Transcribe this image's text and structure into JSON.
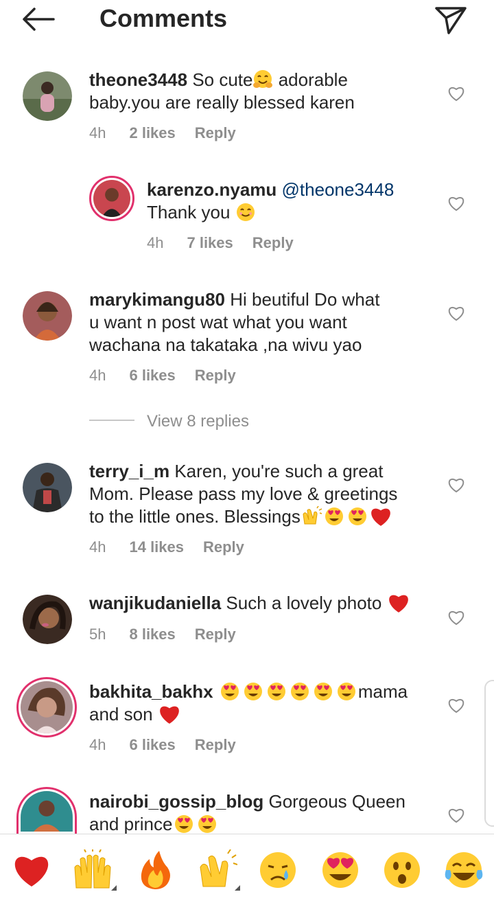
{
  "header": {
    "title": "Comments",
    "back_icon": "back-arrow-icon",
    "send_icon": "send-icon"
  },
  "comments": [
    {
      "username": "theone3448",
      "text_line1": "So cute",
      "text_line1b": " adorable",
      "text_line2": "baby.you are really blessed karen",
      "time": "4h",
      "likes": "2 likes",
      "reply": "Reply",
      "emoji": [
        "hugging-face"
      ]
    },
    {
      "username": "karenzo.nyamu",
      "mention": "@theone3448",
      "text_line2": "Thank you",
      "time": "4h",
      "likes": "7 likes",
      "reply": "Reply",
      "emoji": [
        "smiling-face"
      ]
    },
    {
      "username": "marykimangu80",
      "text_line1": "Hi beutiful Do what",
      "text_line2": "u want n post wat what you want",
      "text_line3": "wachana na takataka ,na wivu yao",
      "time": "4h",
      "likes": "6 likes",
      "reply": "Reply"
    },
    {
      "username": "terry_i_m",
      "text_line1": "Karen, you're such a great",
      "text_line2": "Mom. Please pass my love & greetings",
      "text_line3": "to the little ones. Blessings",
      "time": "4h",
      "likes": "14 likes",
      "reply": "Reply",
      "emoji": [
        "clapping-hands",
        "heart-eyes",
        "heart-eyes",
        "red-heart"
      ]
    },
    {
      "username": "wanjikudaniella",
      "text_line1": "Such a lovely photo",
      "time": "5h",
      "likes": "8 likes",
      "reply": "Reply",
      "emoji": [
        "red-heart"
      ]
    },
    {
      "username": "bakhita_bakhx",
      "text_line1": "mama",
      "text_line2": "and son",
      "time": "4h",
      "likes": "6 likes",
      "reply": "Reply",
      "emoji": [
        "heart-eyes",
        "heart-eyes",
        "heart-eyes",
        "heart-eyes",
        "heart-eyes",
        "heart-eyes",
        "red-heart"
      ]
    },
    {
      "username": "nairobi_gossip_blog",
      "text_line1": "Gorgeous Queen",
      "text_line2": "and prince",
      "emoji": [
        "heart-eyes",
        "heart-eyes"
      ]
    }
  ],
  "view_replies": "View 8 replies",
  "emoji_bar": [
    "red-heart",
    "raising-hands",
    "fire",
    "clapping-hands",
    "crying-face",
    "heart-eyes",
    "astonished-face",
    "tears-of-joy"
  ],
  "colors": {
    "text": "#262626",
    "secondary": "#8e8e8e",
    "mention": "#003569",
    "heart": "#e0245e",
    "emoji_yellow": "#ffcc33"
  }
}
